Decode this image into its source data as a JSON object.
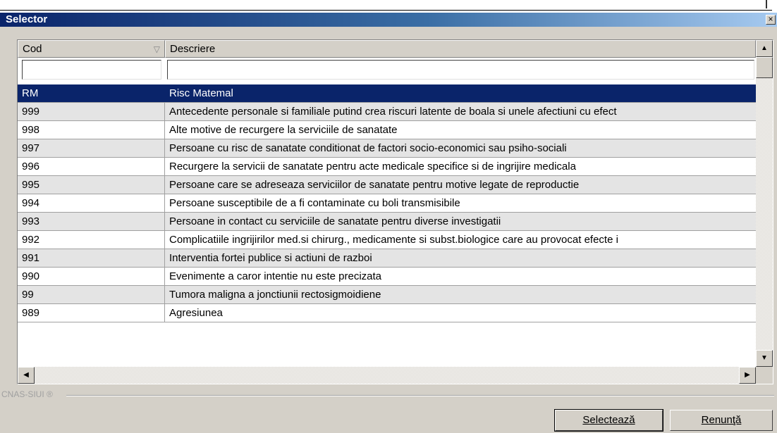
{
  "window": {
    "title": "Selector",
    "close_glyph": "×"
  },
  "grid": {
    "columns": [
      {
        "label": "Cod",
        "sort_icon": "sort-down-icon"
      },
      {
        "label": "Descriere"
      }
    ],
    "filters": {
      "cod": "",
      "descriere": ""
    },
    "selected_index": 0,
    "rows": [
      {
        "cod": "RM",
        "descriere": "Risc Matemal"
      },
      {
        "cod": "999",
        "descriere": "Antecedente personale si familiale putind crea riscuri latente de boala si unele afectiuni cu efect"
      },
      {
        "cod": "998",
        "descriere": "Alte motive de recurgere la serviciile de sanatate"
      },
      {
        "cod": "997",
        "descriere": "Persoane cu risc de sanatate conditionat de factori socio-economici sau psiho-sociali"
      },
      {
        "cod": "996",
        "descriere": "Recurgere la servicii de sanatate pentru acte medicale specifice si de ingrijire medicala"
      },
      {
        "cod": "995",
        "descriere": "Persoane care se adreseaza serviciilor de sanatate pentru motive legate de reproductie"
      },
      {
        "cod": "994",
        "descriere": "Persoane susceptibile de a fi contaminate cu boli transmisibile"
      },
      {
        "cod": "993",
        "descriere": "Persoane in contact cu serviciile de sanatate pentru diverse investigatii"
      },
      {
        "cod": "992",
        "descriere": "Complicatiile ingrijirilor med.si chirurg., medicamente si subst.biologice care au provocat efecte i"
      },
      {
        "cod": "991",
        "descriere": "Interventia fortei publice si actiuni de razboi"
      },
      {
        "cod": "990",
        "descriere": "Evenimente a caror intentie nu este precizata"
      },
      {
        "cod": "99",
        "descriere": "Tumora maligna a jonctiunii rectosigmoidiene"
      },
      {
        "cod": "989",
        "descriere": "Agresiunea"
      }
    ]
  },
  "footer": {
    "group_label": "CNAS-SIUI ®",
    "select_button": "Selectează",
    "cancel_button": "Renunţă"
  },
  "colors": {
    "selection": "#0a246a",
    "title_start": "#0a246a",
    "face": "#d4d0c8"
  }
}
